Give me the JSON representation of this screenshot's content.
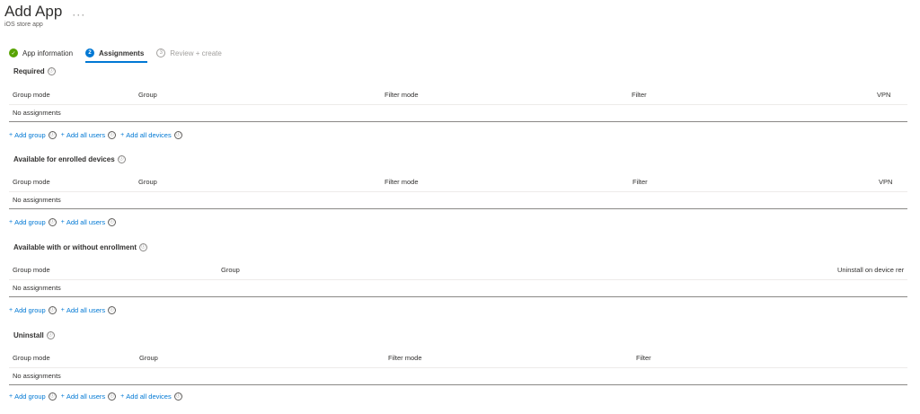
{
  "header": {
    "title": "Add App",
    "more": "···",
    "subtitle": "iOS store app"
  },
  "steps": [
    {
      "label": "App information",
      "badge": "✓",
      "state": "done"
    },
    {
      "label": "Assignments",
      "badge": "2",
      "state": "active"
    },
    {
      "label": "Review + create",
      "badge": "3",
      "state": "future"
    }
  ],
  "sections": {
    "required": {
      "title": "Required",
      "columns": [
        "Group mode",
        "Group",
        "Filter mode",
        "Filter",
        "VPN"
      ],
      "empty": "No assignments",
      "actions": [
        "Add group",
        "Add all users",
        "Add all devices"
      ]
    },
    "available_enrolled": {
      "title": "Available for enrolled devices",
      "columns": [
        "Group mode",
        "Group",
        "Filter mode",
        "Filter",
        "VPN"
      ],
      "empty": "No assignments",
      "actions": [
        "Add group",
        "Add all users"
      ]
    },
    "available_any": {
      "title": "Available with or without enrollment",
      "columns": [
        "Group mode",
        "Group",
        "Uninstall on device rer"
      ],
      "empty": "No assignments",
      "actions": [
        "Add group",
        "Add all users"
      ]
    },
    "uninstall": {
      "title": "Uninstall",
      "columns": [
        "Group mode",
        "Group",
        "Filter mode",
        "Filter"
      ],
      "empty": "No assignments",
      "actions": [
        "Add group",
        "Add all users",
        "Add all devices"
      ]
    }
  },
  "icons": {
    "info": "ⓘ",
    "plus": "+"
  },
  "colors": {
    "accent": "#0078d4",
    "done": "#57a300",
    "disabled": "#a19f9d"
  }
}
